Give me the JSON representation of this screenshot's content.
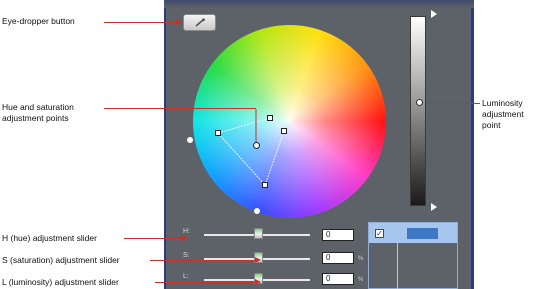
{
  "callouts": {
    "eyedropper": "Eye-dropper button",
    "hue_sat": "Hue and saturation adjustment points",
    "luminosity": "Luminosity adjustment point",
    "h_slider": "H (hue) adjustment slider",
    "s_slider": "S (saturation) adjustment slider",
    "l_slider": "L (luminosity) adjustment slider"
  },
  "sliders": [
    {
      "label": "H:",
      "value": "0",
      "unit": ""
    },
    {
      "label": "S:",
      "value": "0",
      "unit": "%"
    },
    {
      "label": "L:",
      "value": "0",
      "unit": "%"
    }
  ],
  "colors": {
    "panel": "#5d6268",
    "callout_line": "#c8302a",
    "preview_swatch": "#3e78c4"
  },
  "icons": {
    "eyedropper": "eyedropper-icon",
    "check": "checkbox-checked-icon"
  }
}
